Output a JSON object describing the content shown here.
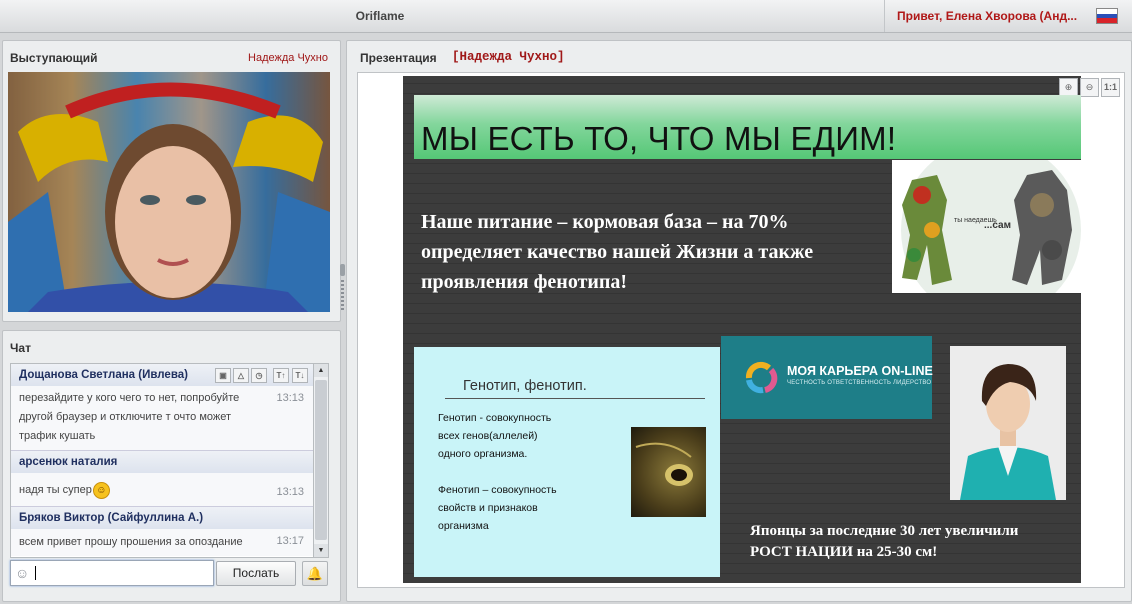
{
  "topbar": {
    "app_title": "Oriflame",
    "greeting": "Привет, Елена Хворова (Анд...",
    "flag": [
      "#ffffff",
      "#2b4fb8",
      "#d8232a"
    ]
  },
  "presenter": {
    "title": "Выступающий",
    "name": "Надежда Чухно"
  },
  "chat": {
    "title": "Чат",
    "messages": [
      {
        "author": "Дощанова Светлана (Ивлева)",
        "lines": [
          "перезайдите у кого чего то нет, попробуйте",
          "другой браузер и отключите т очто может",
          "трафик кушать"
        ],
        "time": "13:13"
      },
      {
        "author": "арсенюк наталия",
        "lines": [
          "надя ты супер"
        ],
        "time": "13:13"
      },
      {
        "author": "Бряков Виктор (Сайфуллина А.)",
        "lines": [
          "всем привет  прошу прошения за опоздание"
        ],
        "time": "13:17"
      }
    ],
    "input_value": "",
    "send_label": "Послать"
  },
  "presentation": {
    "title": "Презентация",
    "presenter": "[Надежда Чухно]",
    "zoom_fit": "1:1",
    "slide": {
      "title": "МЫ ЕСТЬ ТО, ЧТО МЫ ЕДИМ!",
      "main_text": "Наше питание – кормовая база – на 70% определяет качество нашей Жизни а также проявления фенотипа!",
      "food_caption": "...сам",
      "genotype_title": "Генотип, фенотип.",
      "genotype_def": [
        "Генотип - совокупность",
        "всех генов(аллелей)",
        "одного организма."
      ],
      "phenotype_def": [
        "Фенотип – совокупность",
        "свойств и признаков",
        "организма"
      ],
      "career_title": "МОЯ КАРЬЕРА ON-LINE",
      "career_sub": "ЧЕСТНОСТЬ ОТВЕТСТВЕННОСТЬ ЛИДЕРСТВО",
      "japan_text": [
        "Японцы за последние 30 лет увеличили",
        "РОСТ НАЦИИ на 25-30 см!"
      ]
    }
  }
}
